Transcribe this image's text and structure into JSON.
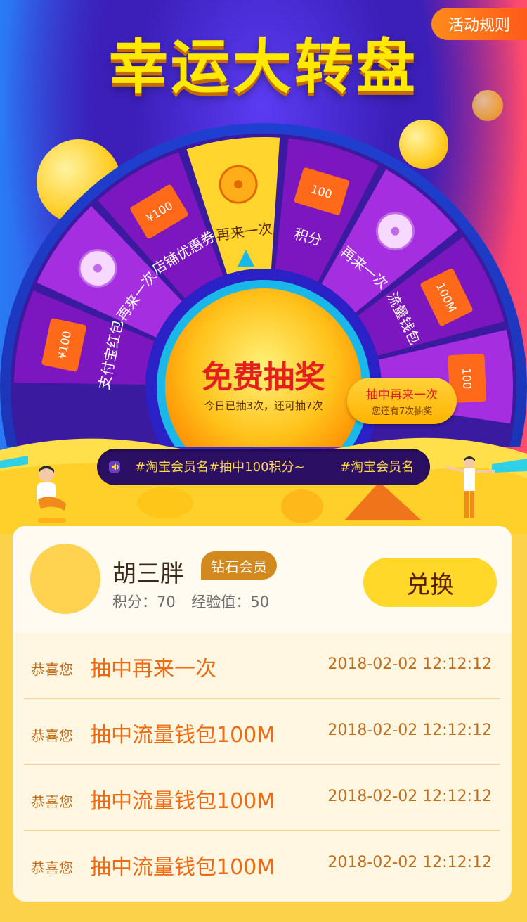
{
  "page": {
    "title": "幸运大转盘",
    "rules_button": "活动规则"
  },
  "wheel": {
    "segments": [
      {
        "label": "支付宝红包",
        "icon": "red-envelope-icon",
        "icon_text": "¥100"
      },
      {
        "label": "再来一次",
        "icon": "wheel-icon"
      },
      {
        "label": "店铺优惠券",
        "icon": "red-envelope-icon",
        "icon_text": "¥100"
      },
      {
        "label": "再来一次",
        "icon": "wheel-icon"
      },
      {
        "label": "积分",
        "icon": "red-envelope-icon",
        "icon_text": "100"
      },
      {
        "label": "再来一次",
        "icon": "wheel-icon"
      },
      {
        "label": "流量钱包",
        "icon": "red-envelope-icon",
        "icon_text": "100M"
      },
      {
        "label": "",
        "icon": "red-envelope-icon",
        "icon_text": "100"
      }
    ],
    "center_button": "免费抽奖",
    "center_sub": "今日已抽3次，还可抽7次",
    "bubble_title": "抽中再来一次",
    "bubble_sub": "您还有7次抽奖"
  },
  "marquee": {
    "text1": "#淘宝会员名#抽中100积分~",
    "text2": "#淘宝会员名"
  },
  "user": {
    "name": "胡三胖",
    "badge": "钻石会员",
    "points_label": "积分：70",
    "exp_label": "经验值：50",
    "exchange_button": "兑换"
  },
  "records": [
    {
      "prefix": "恭喜您",
      "prize": "抽中再来一次",
      "date": "2018-02-02  12:12:12"
    },
    {
      "prefix": "恭喜您",
      "prize": "抽中流量钱包100M",
      "date": "2018-02-02  12:12:12"
    },
    {
      "prefix": "恭喜您",
      "prize": "抽中流量钱包100M",
      "date": "2018-02-02  12:12:12"
    },
    {
      "prefix": "恭喜您",
      "prize": "抽中流量钱包100M",
      "date": "2018-02-02  12:12:12"
    }
  ],
  "colors": {
    "title": "#ffe900",
    "wheel_purple": "#a42ee0",
    "wheel_dark": "#7c16bf",
    "wheel_yellow": "#ffd52e",
    "prize_text": "#f06a14",
    "date_text": "#c06e1e"
  }
}
